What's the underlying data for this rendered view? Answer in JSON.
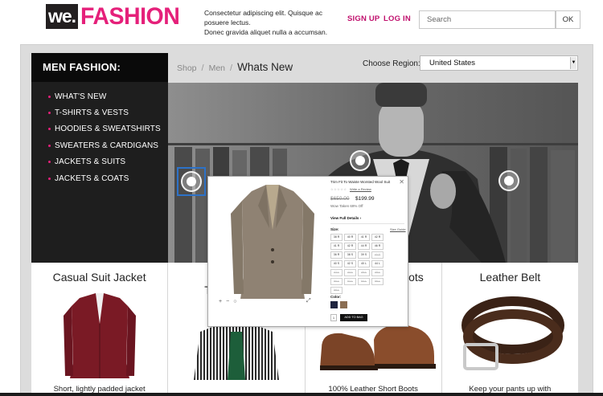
{
  "brand": {
    "logo_we": "we.",
    "logo_fashion": "FASHION",
    "pink": "#e5207a"
  },
  "header": {
    "tagline_line1": "Consectetur adipiscing elit. Quisque ac posuere lectus.",
    "tagline_line2": "Donec gravida aliquet nulla a accumsan.",
    "signup_label": "SIGN UP",
    "login_label": "LOG IN",
    "search_placeholder": "Search",
    "search_button": "OK"
  },
  "sidebar": {
    "title": "MEN FASHION:",
    "items": [
      {
        "label": "WHAT'S NEW"
      },
      {
        "label": "T-SHIRTS & VESTS"
      },
      {
        "label": "HOODIES & SWEATSHIRTS"
      },
      {
        "label": "SWEATERS & CARDIGANS"
      },
      {
        "label": "JACKETS & SUITS"
      },
      {
        "label": "JACKETS & COATS"
      }
    ]
  },
  "breadcrumb": {
    "shop": "Shop",
    "men": "Men",
    "sep": "/",
    "current": "Whats New"
  },
  "region": {
    "label": "Choose Region:",
    "selected": "United States",
    "chevron_icon": "chevron-down-icon"
  },
  "products": [
    {
      "title": "Casual Suit Jacket",
      "desc": "Short, lightly padded jacket"
    },
    {
      "title": "T",
      "desc": ""
    },
    {
      "title": "oots",
      "desc": "100% Leather Short Boots"
    },
    {
      "title": "Leather Belt",
      "desc": "Keep your pants up with"
    }
  ],
  "quickview": {
    "close": "✕",
    "name": "Trim Fit To Waiste Worsted Wool Suit",
    "stars": "☆☆☆☆☆",
    "review_link": "Write a Review",
    "price_old": "$650.00",
    "price_new": "$199.99",
    "savings": "Wow Taken 69% Off",
    "details_link": "View Full Details ›",
    "size_label": "Size:",
    "size_guide": "Size Guide",
    "sizes": [
      {
        "label": "38 R",
        "na": false
      },
      {
        "label": "40 R",
        "na": false
      },
      {
        "label": "41 R",
        "na": false
      },
      {
        "label": "42 R",
        "na": false
      },
      {
        "label": "41 R",
        "na": false
      },
      {
        "label": "42 R",
        "na": false
      },
      {
        "label": "44 R",
        "na": false
      },
      {
        "label": "46 R",
        "na": false
      },
      {
        "label": "36 R",
        "na": false
      },
      {
        "label": "38 S",
        "na": false
      },
      {
        "label": "39 S",
        "na": false
      },
      {
        "label": "40 S",
        "na": true
      },
      {
        "label": "40 S",
        "na": false
      },
      {
        "label": "42 S",
        "na": false
      },
      {
        "label": "40 L",
        "na": false
      },
      {
        "label": "44 L",
        "na": false
      },
      {
        "label": "42 L",
        "na": true
      },
      {
        "label": "44 L",
        "na": true
      },
      {
        "label": "46 L",
        "na": true
      },
      {
        "label": "48 L",
        "na": true
      },
      {
        "label": "50 L",
        "na": true
      },
      {
        "label": "52 L",
        "na": true
      },
      {
        "label": "54 L",
        "na": true
      },
      {
        "label": "56 L",
        "na": true
      },
      {
        "label": "58 L",
        "na": true
      }
    ],
    "color_label": "Color:",
    "swatches": [
      "#1f2540",
      "#8a6d52"
    ],
    "qty": "1",
    "add_label": "ADD TO BAG",
    "zoom_in": "+",
    "zoom_out": "−",
    "zoom_reset": "○",
    "expand": "⤢"
  }
}
